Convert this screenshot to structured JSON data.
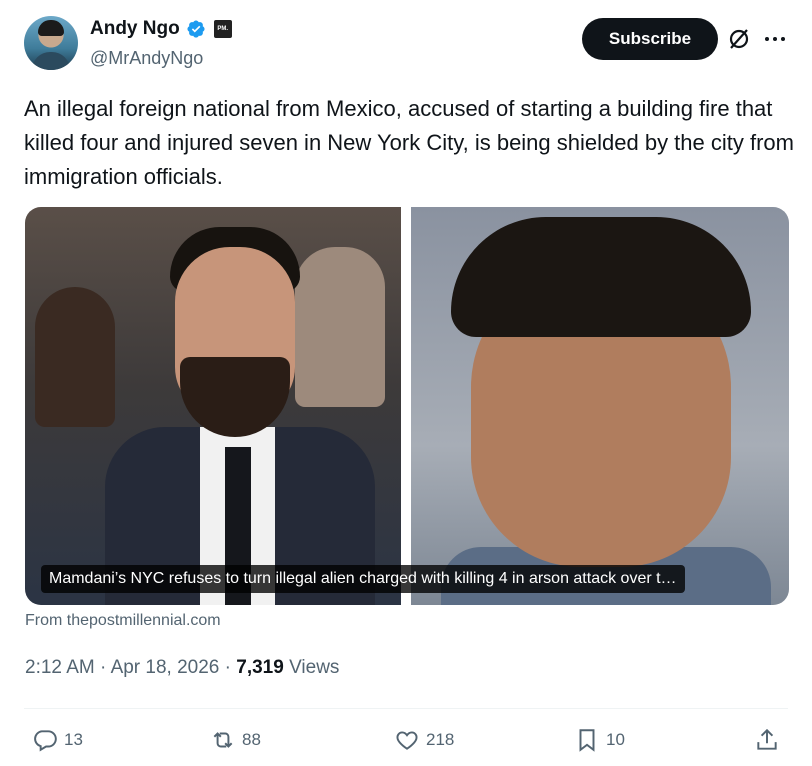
{
  "author": {
    "name": "Andy Ngo",
    "handle": "@MrAndyNgo",
    "affiliation_badge": "PM."
  },
  "header": {
    "subscribe_label": "Subscribe",
    "icons": [
      "grok-icon",
      "more-icon"
    ]
  },
  "tweet": {
    "text": "An illegal foreign national from Mexico, accused of starting a building fire that killed four and injured seven in New York City, is being shielded by the city from immigration officials."
  },
  "card": {
    "caption": "Mamdani’s NYC refuses to turn illegal alien charged with killing 4 in arson attack over t…",
    "source": "From thepostmillennial.com"
  },
  "meta": {
    "time": "2:12 AM",
    "date": "Apr 18, 2026",
    "views_count": "7,319",
    "views_label": "Views"
  },
  "actions": {
    "replies": "13",
    "reposts": "88",
    "likes": "218",
    "bookmarks": "10"
  },
  "colors": {
    "text": "#0f1419",
    "muted": "#536471",
    "verified_blue": "#1d9bf0",
    "button_bg": "#0f1419"
  }
}
